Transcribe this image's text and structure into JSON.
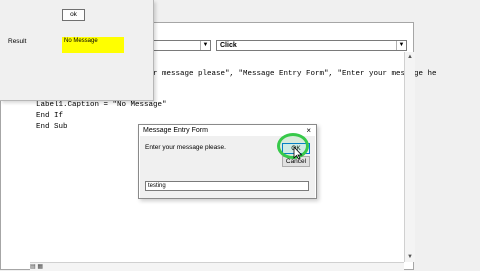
{
  "userform": {
    "ok_label": "ok",
    "result_label": "Result",
    "message_label": "No Message"
  },
  "editor": {
    "object_combo": "",
    "procedure_combo": "Click",
    "code_lines": [
      "r message please\", \"Message Entry Form\", \"Enter your message he",
      "Label1.Caption = \"No Message\"",
      "End If",
      "End Sub"
    ]
  },
  "dialog": {
    "title": "Message Entry Form",
    "close": "×",
    "prompt": "Enter your message please.",
    "ok_label": "OK",
    "cancel_label": "Cancel",
    "input_value": "testing"
  },
  "icons": {
    "close": "close-icon",
    "dropdown": "chevron-down-icon",
    "cursor": "mouse-pointer-icon"
  },
  "colors": {
    "label_highlight": "#ffff00",
    "ring": "#37c94a",
    "ok_border": "#0078d7"
  }
}
